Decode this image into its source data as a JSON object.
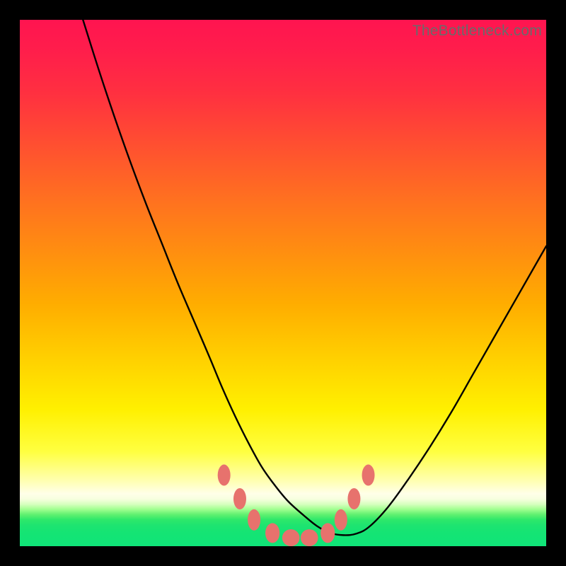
{
  "watermark": "TheBottleneck.com",
  "chart_data": {
    "type": "line",
    "title": "",
    "xlabel": "",
    "ylabel": "",
    "xlim": [
      0,
      100
    ],
    "ylim": [
      0,
      100
    ],
    "series": [
      {
        "name": "bottleneck-curve",
        "x": [
          12,
          15,
          18,
          21,
          24,
          27,
          30,
          33,
          36,
          38.5,
          41,
          43.5,
          46,
          48.5,
          51,
          54,
          56.5,
          59,
          61.5,
          64,
          66.5,
          70,
          74,
          78,
          82,
          86,
          90,
          94,
          98,
          100
        ],
        "values": [
          100,
          90.5,
          81.5,
          73,
          65,
          57.5,
          50,
          43,
          36,
          30,
          24.5,
          19.5,
          15,
          11.5,
          8.5,
          5.8,
          3.8,
          2.5,
          2.1,
          2.4,
          3.8,
          7.5,
          13,
          19,
          25.5,
          32.5,
          39.5,
          46.5,
          53.5,
          57
        ]
      }
    ],
    "annotations": {
      "trough_markers_x": [
        38.8,
        41.8,
        44.5,
        48.0,
        51.5,
        55.0,
        58.5,
        61.0,
        63.5,
        66.2
      ],
      "trough_markers_y": [
        13.5,
        9.0,
        5.0,
        2.5,
        1.6,
        1.6,
        2.5,
        5.0,
        9.0,
        13.5
      ]
    },
    "colors": {
      "curve": "#000000",
      "marker_fill": "#e7726d",
      "gradient_top": "#ff1450",
      "gradient_mid": "#fff000",
      "gradient_bottom": "#10e478"
    }
  }
}
